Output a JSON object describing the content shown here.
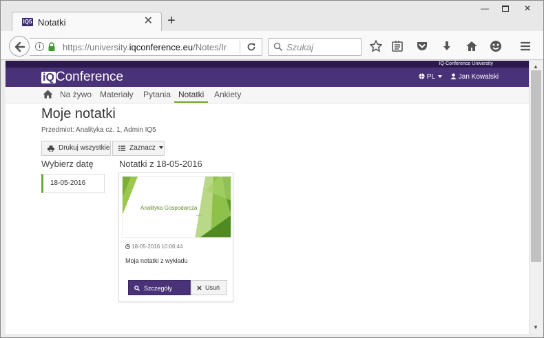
{
  "browser": {
    "tab_title": "Notatki",
    "tab_favicon": "IQ5",
    "url_prefix": "https://university.",
    "url_domain": "iqconference.eu",
    "url_suffix": "/Notes/Ir",
    "search_placeholder": "Szukaj"
  },
  "site": {
    "top_label": "IQ-Conference University",
    "logo_iq": "iQ",
    "logo_text": "Conference",
    "lang": "PL",
    "user": "Jan Kowalski"
  },
  "menu": {
    "items": [
      "Na żywo",
      "Materiały",
      "Pytania",
      "Notatki",
      "Ankiety"
    ],
    "active": "Notatki"
  },
  "page": {
    "title": "Moje notatki",
    "subject": "Przedmiot: Analityka cz. 1, Admin IQ5",
    "print_label": "Drukuj wszystkie",
    "select_label": "Zaznacz",
    "date_heading": "Wybierz datę",
    "dates": [
      "18-05-2016"
    ],
    "notes_heading": "Notatki z 18-05-2016"
  },
  "note": {
    "slide_title": "Analityka Gospodarcza",
    "slide_sub": "Etap 1",
    "timestamp": "18-05-2016 10:06:44",
    "text": "Moja notatki z wykładu",
    "details_label": "Szczegóły",
    "delete_label": "Usuń"
  },
  "colors": {
    "brand_dark": "#2c1a4f",
    "brand": "#4a3278",
    "accent_green": "#6ca72d"
  }
}
